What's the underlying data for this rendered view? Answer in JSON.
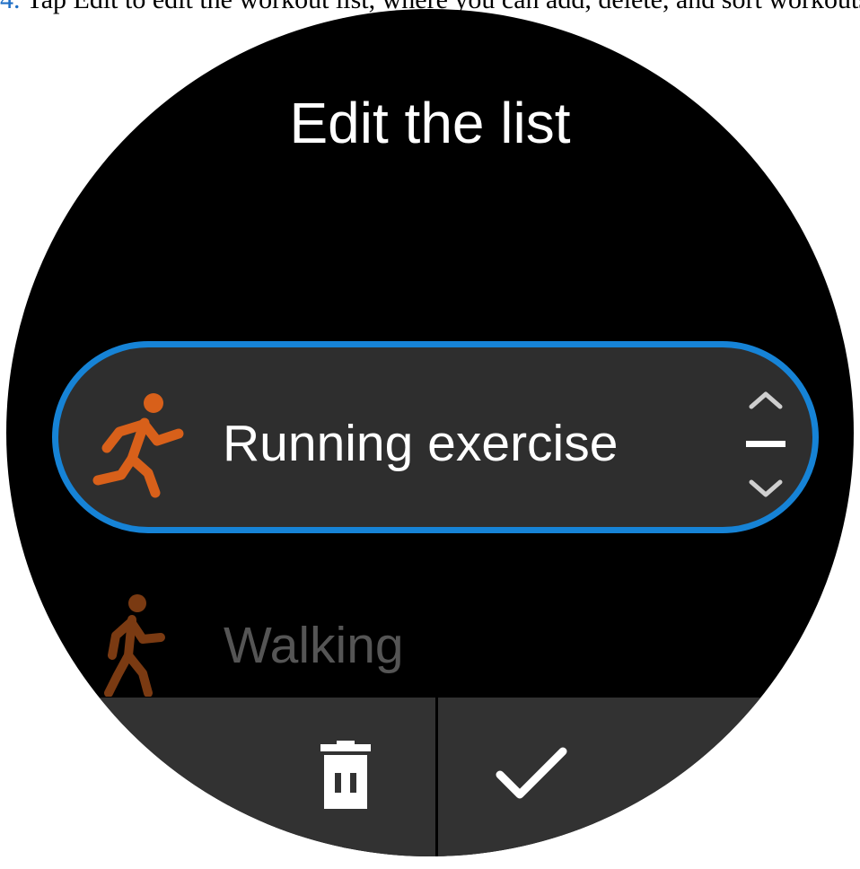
{
  "caption": {
    "step_number": "4.",
    "text": " Tap Edit to edit the workout list, where you can add, delete, and sort workouts."
  },
  "screen": {
    "title": "Edit the list"
  },
  "workouts": [
    {
      "label": "Running exercise",
      "icon": "running-icon",
      "selected": true,
      "icon_color": "#d8601a"
    },
    {
      "label": "Walking",
      "icon": "walking-icon",
      "selected": false,
      "icon_color": "#7a3a12"
    }
  ],
  "actions": {
    "delete_icon": "trash-icon",
    "confirm_icon": "checkmark-icon"
  },
  "colors": {
    "accent": "#1683d6",
    "background": "#000000",
    "selected_row": "#2e2e2e",
    "bottom_bar": "#323232"
  }
}
